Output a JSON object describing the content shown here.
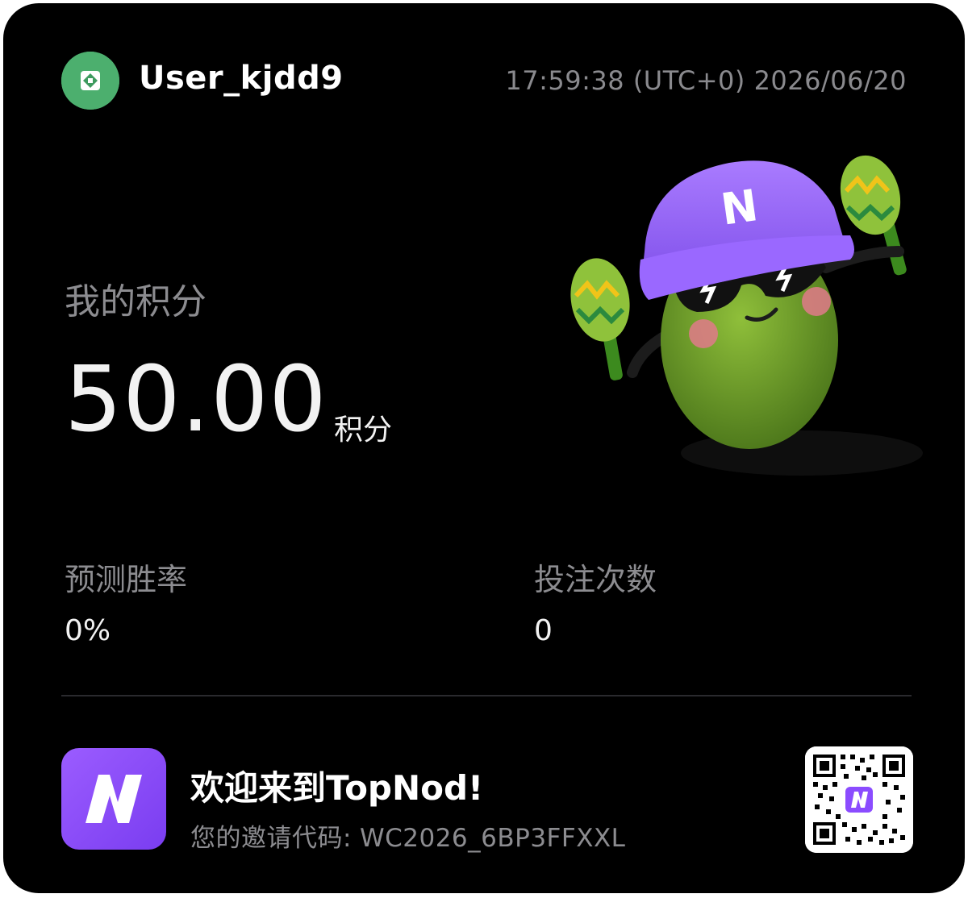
{
  "header": {
    "username": "User_kjdd9",
    "timestamp": "17:59:38 (UTC+0) 2026/06/20"
  },
  "points": {
    "label": "我的积分",
    "value": "50.00",
    "unit": "积分"
  },
  "stats": [
    {
      "label": "预测胜率",
      "value": "0%"
    },
    {
      "label": "投注次数",
      "value": "0"
    }
  ],
  "footer": {
    "welcome": "欢迎来到TopNod!",
    "invite_label": "您的邀请代码:",
    "invite_code": "WC2026_6BP3FFXXL"
  },
  "mascot": {
    "hat_letter": "N"
  },
  "colors": {
    "background": "#000000",
    "brand_purple": "#8b4cff",
    "avatar_green": "#4caf6e",
    "muted_text": "#8c8c90"
  },
  "icons": {
    "avatar": "avatar-icon",
    "app_logo": "topnod-logo-icon",
    "qr": "qr-code-icon"
  }
}
